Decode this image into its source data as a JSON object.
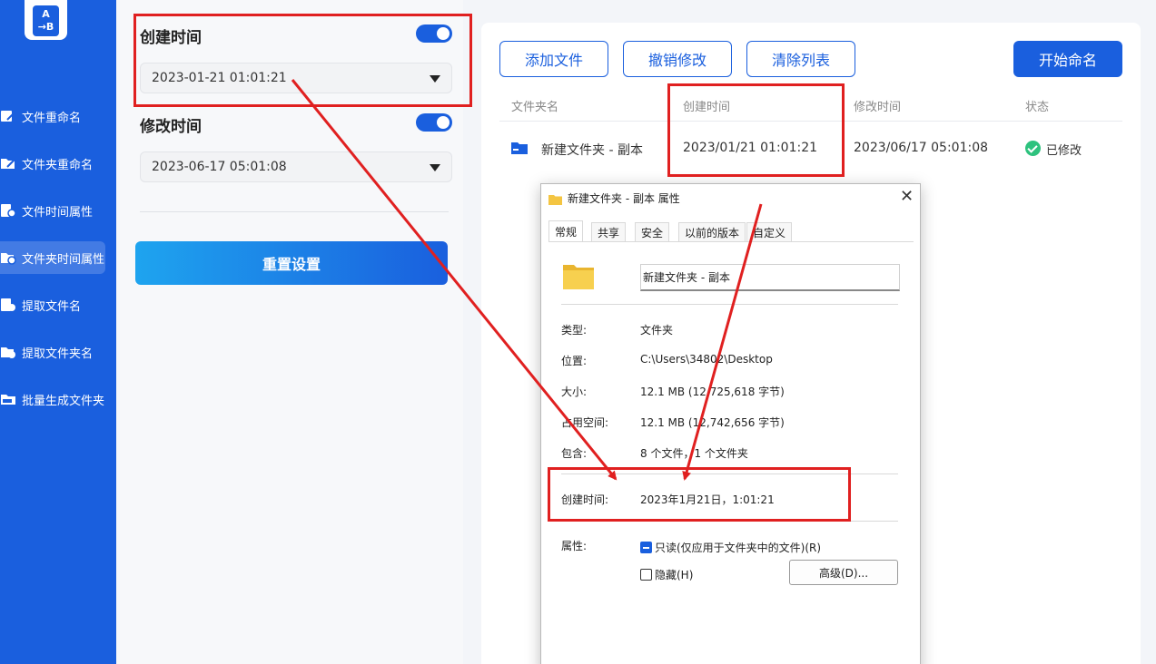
{
  "sidebar": {
    "items": [
      {
        "label": "文件重命名",
        "icon": "file-rename-icon"
      },
      {
        "label": "文件夹重命名",
        "icon": "folder-rename-icon"
      },
      {
        "label": "文件时间属性",
        "icon": "file-time-icon"
      },
      {
        "label": "文件夹时间属性",
        "icon": "folder-time-icon"
      },
      {
        "label": "提取文件名",
        "icon": "extract-file-icon"
      },
      {
        "label": "提取文件夹名",
        "icon": "extract-folder-icon"
      },
      {
        "label": "批量生成文件夹",
        "icon": "batch-folder-icon"
      }
    ]
  },
  "settings": {
    "created": {
      "label": "创建时间",
      "value": "2023-01-21 01:01:21",
      "enabled": true
    },
    "modified": {
      "label": "修改时间",
      "value": "2023-06-17 05:01:08",
      "enabled": true
    },
    "reset_label": "重置设置"
  },
  "toolbar": {
    "add_label": "添加文件",
    "undo_label": "撤销修改",
    "clear_label": "清除列表",
    "start_label": "开始命名"
  },
  "table": {
    "headers": [
      "文件夹名",
      "创建时间",
      "修改时间",
      "状态"
    ],
    "rows": [
      {
        "name": "新建文件夹 - 副本",
        "created": "2023/01/21 01:01:21",
        "modified": "2023/06/17 05:01:08",
        "status": "已修改"
      }
    ]
  },
  "dialog": {
    "title": "新建文件夹 - 副本 属性",
    "tabs": [
      "常规",
      "共享",
      "安全",
      "以前的版本",
      "自定义"
    ],
    "name_value": "新建文件夹 - 副本",
    "props": [
      {
        "label": "类型:",
        "value": "文件夹"
      },
      {
        "label": "位置:",
        "value": "C:\\Users\\34802\\Desktop"
      },
      {
        "label": "大小:",
        "value": "12.1 MB (12,725,618 字节)"
      },
      {
        "label": "占用空间:",
        "value": "12.1 MB (12,742,656 字节)"
      },
      {
        "label": "包含:",
        "value": "8 个文件，1 个文件夹"
      }
    ],
    "created_label": "创建时间:",
    "created_value": "2023年1月21日，1:01:21",
    "attr_label": "属性:",
    "readonly_label": "只读(仅应用于文件夹中的文件)(R)",
    "hidden_label": "隐藏(H)",
    "advanced_label": "高级(D)...",
    "close_glyph": "✕"
  },
  "colors": {
    "accent": "#1a5fde",
    "annotation": "#e02020",
    "success": "#2ec27e"
  }
}
